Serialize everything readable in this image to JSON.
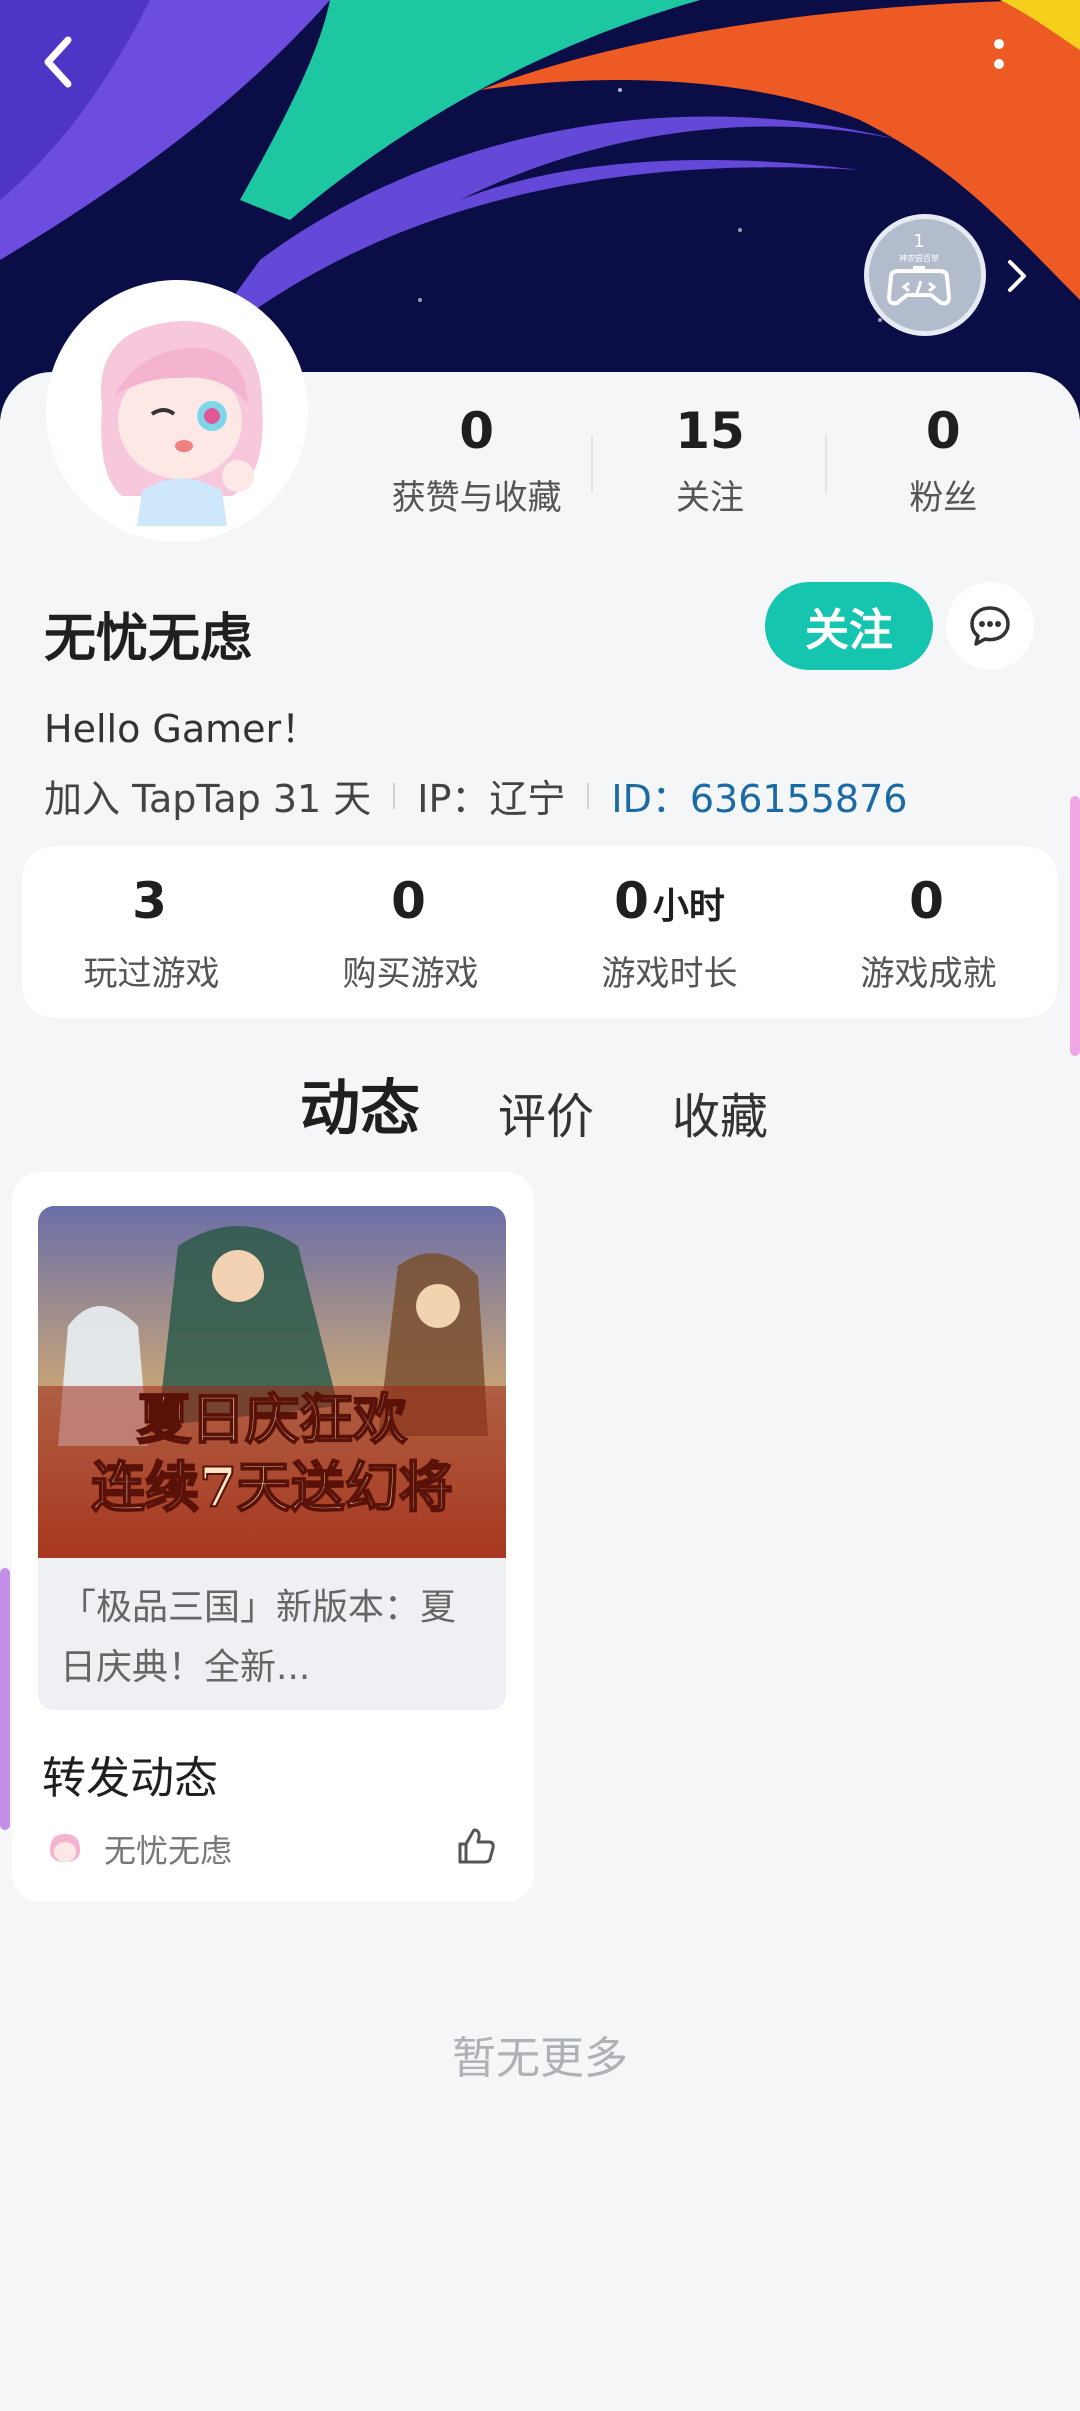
{
  "header": {
    "badge_level": "1",
    "badge_title": "神农尝百草"
  },
  "profile": {
    "stats": [
      {
        "value": "0",
        "label": "获赞与收藏"
      },
      {
        "value": "15",
        "label": "关注"
      },
      {
        "value": "0",
        "label": "粉丝"
      }
    ],
    "username": "无忧无虑",
    "follow_label": "关注",
    "bio": "Hello Gamer！",
    "joined": "加入 TapTap 31 天",
    "ip": "IP：辽宁",
    "user_id": "ID：636155876"
  },
  "game_stats": [
    {
      "value": "3",
      "unit": "",
      "label": "玩过游戏"
    },
    {
      "value": "0",
      "unit": "",
      "label": "购买游戏"
    },
    {
      "value": "0",
      "unit": "小时",
      "label": "游戏时长"
    },
    {
      "value": "0",
      "unit": "",
      "label": "游戏成就"
    }
  ],
  "tabs": [
    {
      "label": "动态",
      "active": true
    },
    {
      "label": "评价",
      "active": false
    },
    {
      "label": "收藏",
      "active": false
    }
  ],
  "post": {
    "image_text_line1": "夏日庆狂欢",
    "image_text_line2": "连续7天送幻将",
    "repost_text": "「极品三国」新版本：夏日庆典！全新...",
    "title": "转发动态",
    "author": "无忧无虑"
  },
  "footer": {
    "no_more": "暂无更多"
  },
  "colors": {
    "accent": "#15c5b0",
    "link": "#1a6aa3"
  }
}
